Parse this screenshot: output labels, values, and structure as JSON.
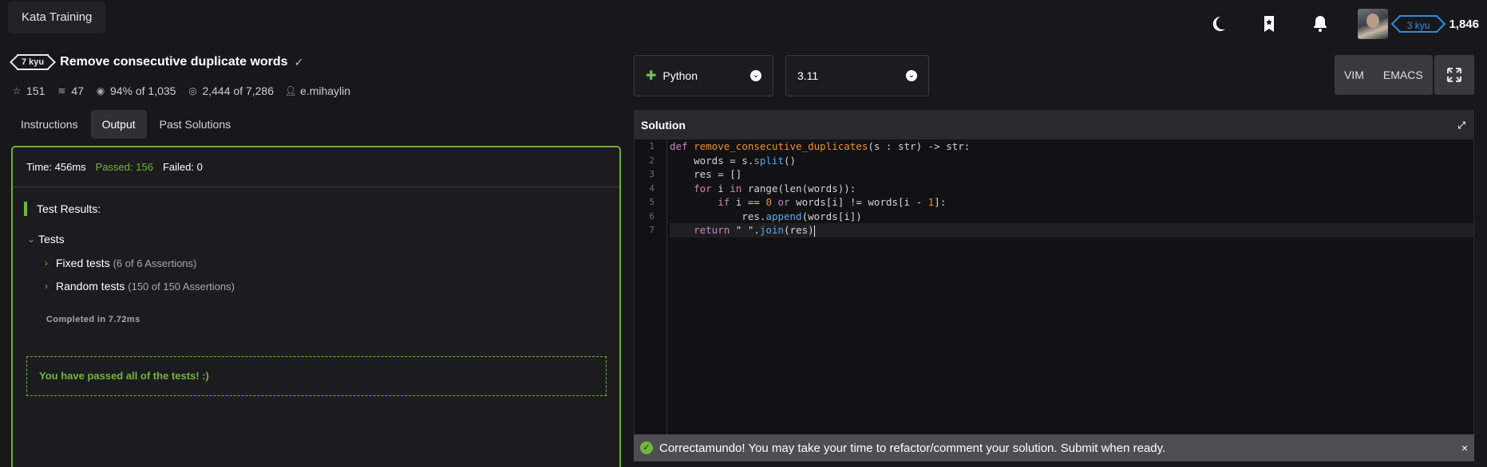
{
  "topbar": {
    "brand": "Kata Training",
    "icons": [
      "moon-icon",
      "bookmark-icon",
      "bell-icon"
    ],
    "rank": "3 kyu",
    "honor": "1,846"
  },
  "kata": {
    "rank": "7 kyu",
    "title": "Remove consecutive duplicate words",
    "stats": {
      "stars": "151",
      "collections": "47",
      "satisfaction": "94%",
      "satisfaction_of": "of 1,035",
      "completed": "2,444",
      "completed_of": "of 7,286",
      "author": "e.mihaylin"
    }
  },
  "tabs": [
    {
      "label": "Instructions",
      "active": false
    },
    {
      "label": "Output",
      "active": true
    },
    {
      "label": "Past Solutions",
      "active": false
    }
  ],
  "output": {
    "time": "Time: 456ms",
    "passed": "Passed: 156",
    "failed": "Failed: 0",
    "results_title": "Test Results:",
    "tests_label": "Tests",
    "fixed_label": "Fixed tests",
    "fixed_count": "(6 of 6 Assertions)",
    "random_label": "Random tests",
    "random_count": "(150 of 150 Assertions)",
    "completed": "Completed in 7.72ms",
    "pass_message": "You have passed all of the tests! :)"
  },
  "editor": {
    "language": "Python",
    "version": "3.11",
    "modes": [
      "VIM",
      "EMACS"
    ],
    "panel_title": "Solution",
    "line_numbers": [
      "1",
      "2",
      "3",
      "4",
      "5",
      "6",
      "7"
    ],
    "active_line": 7
  },
  "notice": {
    "message": "Correctamundo! You may take your time to refactor/comment your solution. Submit when ready.",
    "close": "×"
  },
  "colors": {
    "accent_green": "#74b43c",
    "rank_blue": "#2f8be6",
    "background": "#18181b"
  }
}
